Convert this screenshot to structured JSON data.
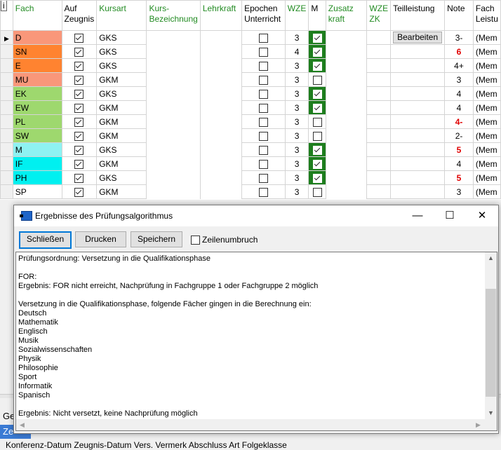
{
  "grid": {
    "info_label": "i",
    "headers": {
      "fach": "Fach",
      "auf_zeugnis": [
        "Auf",
        "Zeugnis"
      ],
      "kursart": "Kursart",
      "kurs_bezeichnung": [
        "Kurs-",
        "Bezeichnung"
      ],
      "lehrkraft": "Lehrkraft",
      "epochen": [
        "Epochen",
        "Unterricht"
      ],
      "wze": "WZE",
      "m": "M",
      "zusatzkraft": [
        "Zusatz",
        "kraft"
      ],
      "wze_zk": [
        "WZE",
        "ZK"
      ],
      "teilleistung": "Teilleistung",
      "note": "Note",
      "fachleistung": [
        "Fach",
        "Leistu"
      ]
    },
    "bearbeiten_label": "Bearbeiten",
    "mem_text": "(Mem",
    "rows": [
      {
        "fach": "D",
        "color": "#f9977a",
        "zeugnis": true,
        "kursart": "GKS",
        "epochen": false,
        "wze": "3",
        "m": true,
        "note": "3-",
        "note_red": false
      },
      {
        "fach": "SN",
        "color": "#ff8330",
        "zeugnis": true,
        "kursart": "GKS",
        "epochen": false,
        "wze": "4",
        "m": true,
        "note": "6",
        "note_red": true
      },
      {
        "fach": "E",
        "color": "#ff8330",
        "zeugnis": true,
        "kursart": "GKS",
        "epochen": false,
        "wze": "3",
        "m": true,
        "note": "4+",
        "note_red": false
      },
      {
        "fach": "MU",
        "color": "#f9977a",
        "zeugnis": true,
        "kursart": "GKM",
        "epochen": false,
        "wze": "3",
        "m": false,
        "note": "3",
        "note_red": false
      },
      {
        "fach": "EK",
        "color": "#9ed86e",
        "zeugnis": true,
        "kursart": "GKS",
        "epochen": false,
        "wze": "3",
        "m": true,
        "note": "4",
        "note_red": false
      },
      {
        "fach": "EW",
        "color": "#9ed86e",
        "zeugnis": true,
        "kursart": "GKM",
        "epochen": false,
        "wze": "3",
        "m": true,
        "note": "4",
        "note_red": false
      },
      {
        "fach": "PL",
        "color": "#9ed86e",
        "zeugnis": true,
        "kursart": "GKM",
        "epochen": false,
        "wze": "3",
        "m": false,
        "note": "4-",
        "note_red": true
      },
      {
        "fach": "SW",
        "color": "#9ed86e",
        "zeugnis": true,
        "kursart": "GKM",
        "epochen": false,
        "wze": "3",
        "m": false,
        "note": "2-",
        "note_red": false
      },
      {
        "fach": "M",
        "color": "#8ef2f2",
        "zeugnis": true,
        "kursart": "GKS",
        "epochen": false,
        "wze": "3",
        "m": true,
        "note": "5",
        "note_red": true
      },
      {
        "fach": "IF",
        "color": "#00f0f0",
        "zeugnis": true,
        "kursart": "GKM",
        "epochen": false,
        "wze": "3",
        "m": true,
        "note": "4",
        "note_red": false
      },
      {
        "fach": "PH",
        "color": "#00f0f0",
        "zeugnis": true,
        "kursart": "GKS",
        "epochen": false,
        "wze": "3",
        "m": true,
        "note": "5",
        "note_red": true
      },
      {
        "fach": "SP",
        "color": "#ffffff",
        "zeugnis": true,
        "kursart": "GKM",
        "epochen": false,
        "wze": "3",
        "m": false,
        "note": "3",
        "note_red": false
      }
    ]
  },
  "bottom": {
    "tab_ge": "Ge",
    "tab_ze": "Ze",
    "row3_text": "Konferenz-Datum   Zeugnis-Datum      Vers. Vermerk             Abschluss Art                         Folgeklasse"
  },
  "dialog": {
    "title": "Ergebnisse des Prüfungsalgorithmus",
    "minimize": "—",
    "maximize": "☐",
    "close": "✕",
    "buttons": {
      "schliessen": "Schließen",
      "drucken": "Drucken",
      "speichern": "Speichern"
    },
    "wrap_label": "Zeilenumbruch",
    "wrap_checked": false,
    "lines": [
      "Prüfungsordnung: Versetzung in die Qualifikationsphase",
      "",
      "FOR:",
      "Ergebnis: FOR nicht erreicht, Nachprüfung in Fachgruppe 1 oder Fachgruppe 2 möglich",
      "",
      "Versetzung in die Qualifikationsphase, folgende Fächer gingen in die Berechnung ein:",
      "Deutsch",
      "Mathematik",
      "Englisch",
      "Musik",
      "Sozialwissenschaften",
      "Physik",
      "Philosophie",
      "Sport",
      "Informatik",
      "Spanisch",
      "",
      "Ergebnis: Nicht versetzt, keine Nachprüfung möglich"
    ]
  },
  "colors": {
    "accent": "#0078d7",
    "m_checked_bg": "#1e7e1e",
    "header_green": "#228b22",
    "note_red": "#e00000"
  }
}
